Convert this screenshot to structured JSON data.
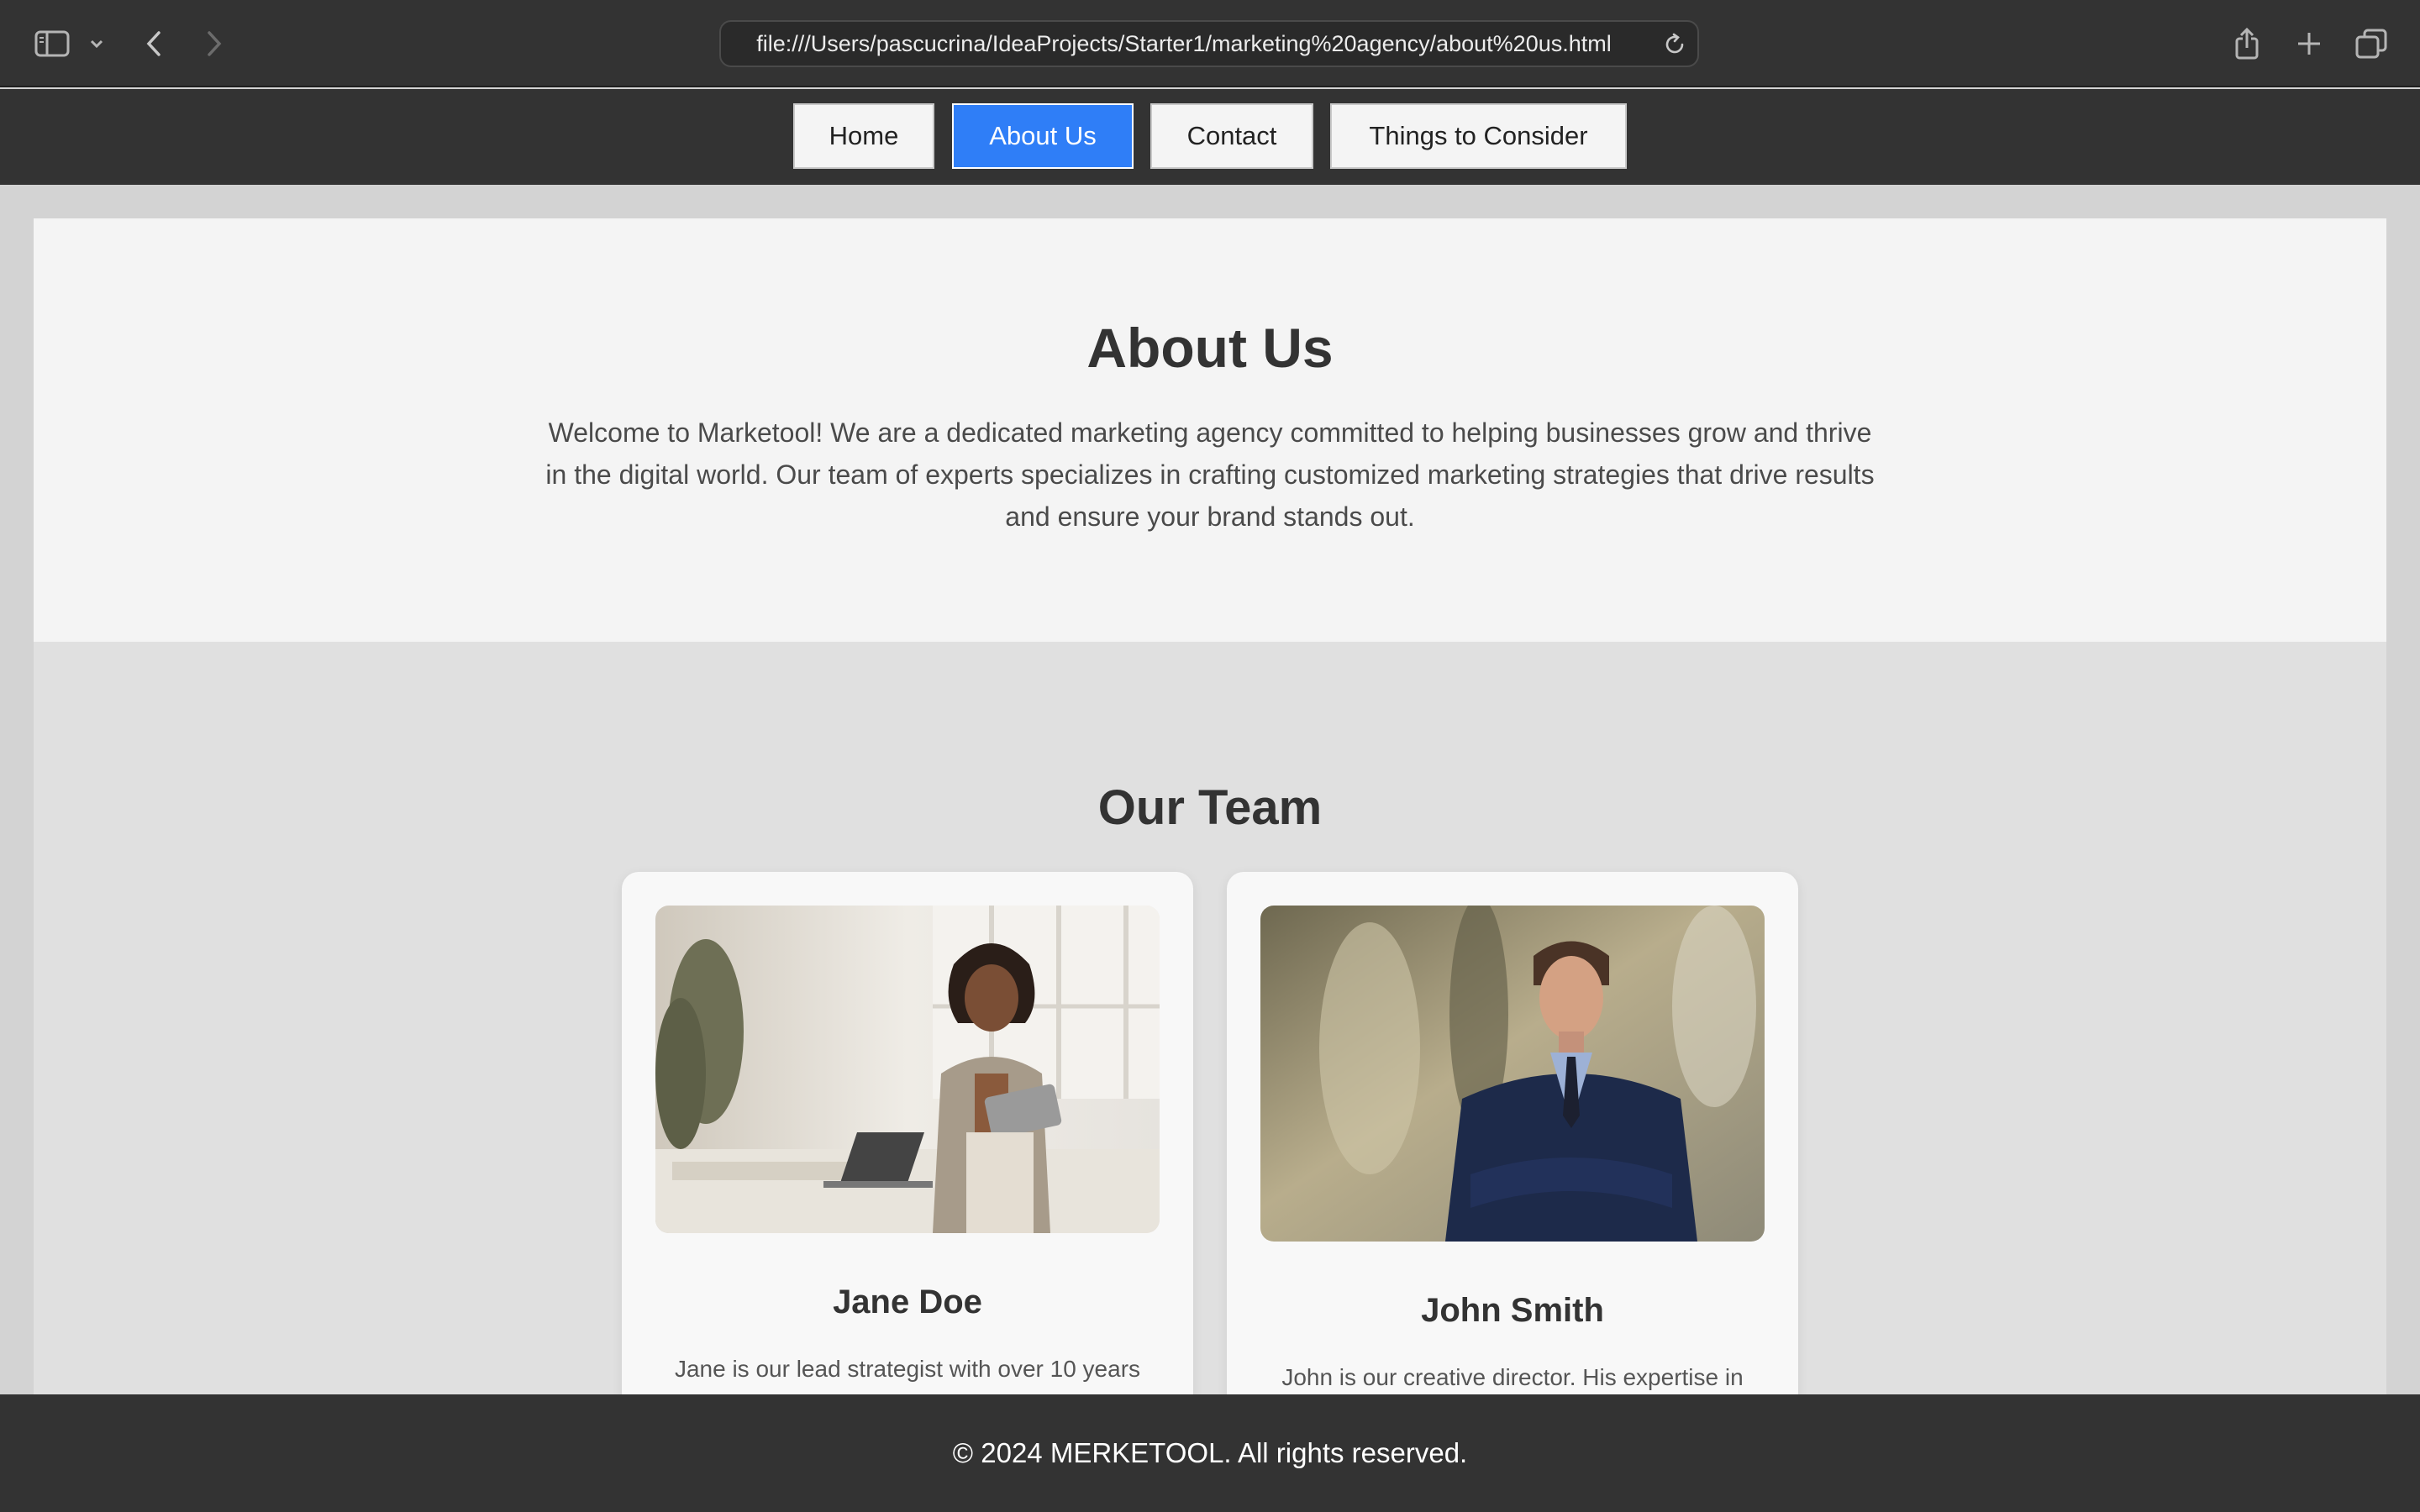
{
  "browser": {
    "url": "file:///Users/pascucrina/IdeaProjects/Starter1/marketing%20agency/about%20us.html",
    "icons": [
      "sidebar-icon",
      "chevron-down-icon",
      "back-icon",
      "forward-icon",
      "reload-icon",
      "share-icon",
      "plus-icon",
      "tabs-icon"
    ]
  },
  "nav": {
    "items": [
      {
        "label": "Home"
      },
      {
        "label": "About Us",
        "active": true
      },
      {
        "label": "Contact"
      },
      {
        "label": "Things to Consider"
      }
    ],
    "active_color": "#2f7ef7"
  },
  "about": {
    "title": "About Us",
    "text": "Welcome to Marketool! We are a dedicated marketing agency committed to helping businesses grow and thrive in the digital world. Our team of experts specializes in crafting customized marketing strategies that drive results and ensure your brand stands out."
  },
  "team": {
    "title": "Our Team",
    "members": [
      {
        "name": "Jane Doe",
        "bio": "Jane is our lead strategist with over 10 years"
      },
      {
        "name": "John Smith",
        "bio": "John is our creative director. His expertise in"
      }
    ]
  },
  "footer": {
    "text": "© 2024 MERKETOOL. All rights reserved."
  }
}
